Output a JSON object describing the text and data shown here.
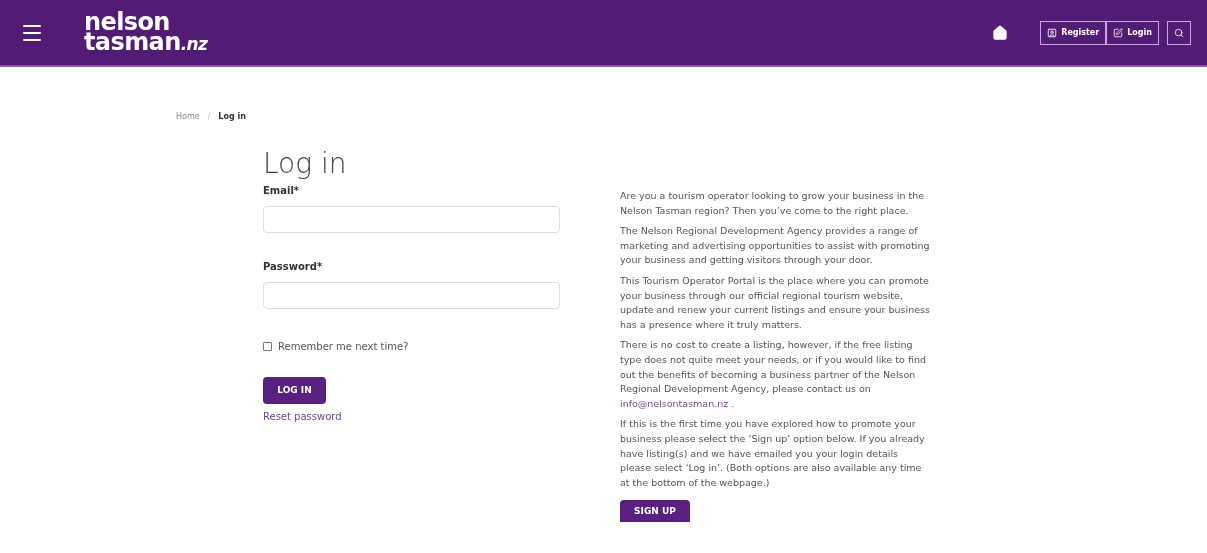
{
  "header": {
    "logo_top": "nelson",
    "logo_bottom": "tasman",
    "logo_suffix": ".nz",
    "buttons": [
      {
        "kind": "register",
        "label": "Register"
      },
      {
        "kind": "login",
        "label": "Login"
      }
    ]
  },
  "breadcrumb": [
    "Home",
    "/",
    "Log in"
  ],
  "login": {
    "title": "Log in",
    "email_label": "Email*",
    "password_label": "Password*",
    "remember": {
      "label": "Remember me next time?",
      "checked": false
    },
    "submit": "LOG IN",
    "reset": "Reset password"
  },
  "info": {
    "paragraphs": [
      {
        "text": "Are you a tourism operator looking to grow your business in the Nelson Tasman region? Then you’ve come to the right place."
      },
      {
        "text": "The Nelson Regional Development Agency provides a range of marketing and advertising opportunities to assist with promoting your business and getting visitors through your door."
      },
      {
        "text": "This Tourism Operator Portal is the place where you can promote your business through our official regional tourism website, update and renew your current listings and ensure your business has a presence where it truly matters."
      },
      {
        "text": "There is no cost to create a listing, however, if the free listing type does not quite meet your needs, or if you would like to find out the benefits of becoming a business partner of the Nelson Regional Development Agency, please contact us on",
        "link": "info@nelsontasman.nz",
        "after": " ."
      },
      {
        "text": "If this is the first time you have explored how to promote your business please select the ‘Sign up’ option below. If you already have listing(s) and we have emailed you your login details please select ‘Log in’. (Both options are also available any time at the bottom of the webpage.)"
      }
    ],
    "signup": "SIGN UP"
  }
}
